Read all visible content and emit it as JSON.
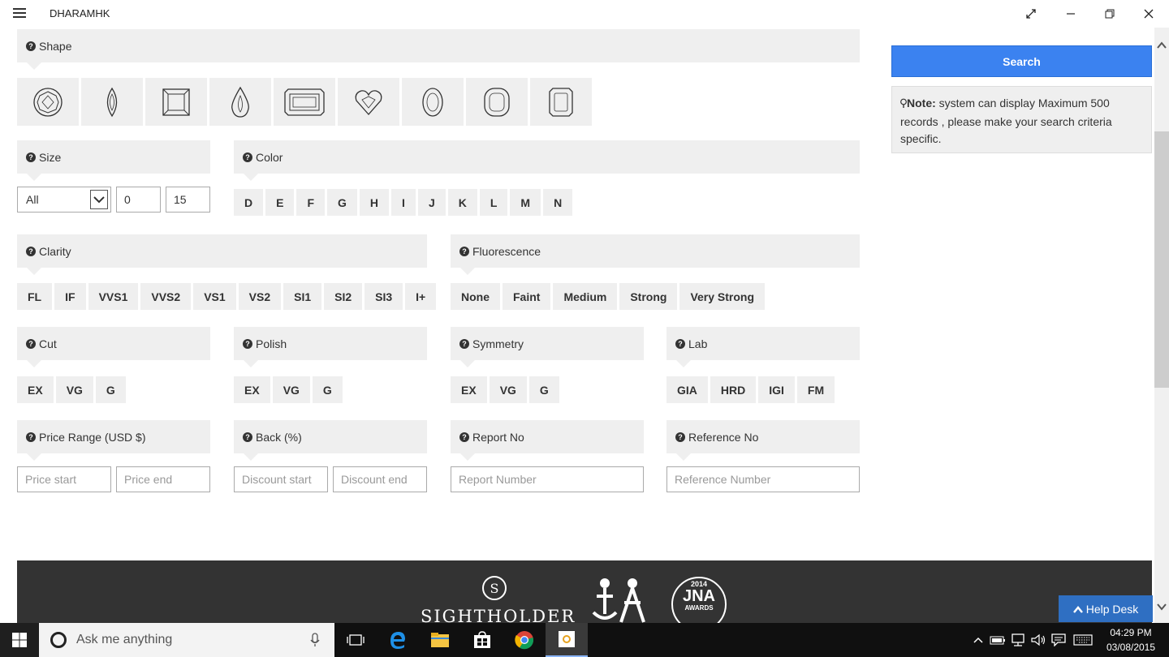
{
  "app": {
    "title": "DHARAMHK"
  },
  "panels": {
    "shape": "Shape",
    "size": "Size",
    "color": "Color",
    "clarity": "Clarity",
    "fluorescence": "Fluorescence",
    "cut": "Cut",
    "polish": "Polish",
    "symmetry": "Symmetry",
    "lab": "Lab",
    "price": "Price Range (USD $)",
    "back": "Back (%)",
    "report": "Report No",
    "reference": "Reference No"
  },
  "size": {
    "selected": "All",
    "from": "0",
    "to": "15"
  },
  "colors": [
    "D",
    "E",
    "F",
    "G",
    "H",
    "I",
    "J",
    "K",
    "L",
    "M",
    "N"
  ],
  "clarity": [
    "FL",
    "IF",
    "VVS1",
    "VVS2",
    "VS1",
    "VS2",
    "SI1",
    "SI2",
    "SI3",
    "I+"
  ],
  "fluorescence": [
    "None",
    "Faint",
    "Medium",
    "Strong",
    "Very Strong"
  ],
  "cut": [
    "EX",
    "VG",
    "G"
  ],
  "polish": [
    "EX",
    "VG",
    "G"
  ],
  "symmetry": [
    "EX",
    "VG",
    "G"
  ],
  "lab": [
    "GIA",
    "HRD",
    "IGI",
    "FM"
  ],
  "placeholders": {
    "price_start": "Price start",
    "price_end": "Price end",
    "discount_start": "Discount start",
    "discount_end": "Discount end",
    "report": "Report Number",
    "reference": "Reference Number"
  },
  "search": {
    "label": "Search"
  },
  "note": {
    "label": "Note:",
    "text": " system can display Maximum 500 records , please make your search criteria specific."
  },
  "footer": {
    "sightholder": "SIGHTHOLDER",
    "jna_year": "2014",
    "jna": "JNA",
    "jna_awards": "AWARDS"
  },
  "helpdesk": {
    "label": "Help Desk"
  },
  "taskbar": {
    "search_placeholder": "Ask me anything",
    "time": "04:29 PM",
    "date": "03/08/2015"
  },
  "colors_ui": {
    "accent": "#3b82f0",
    "panel": "#efefef",
    "footer": "#333333",
    "helpdesk": "#2f6fc2"
  }
}
